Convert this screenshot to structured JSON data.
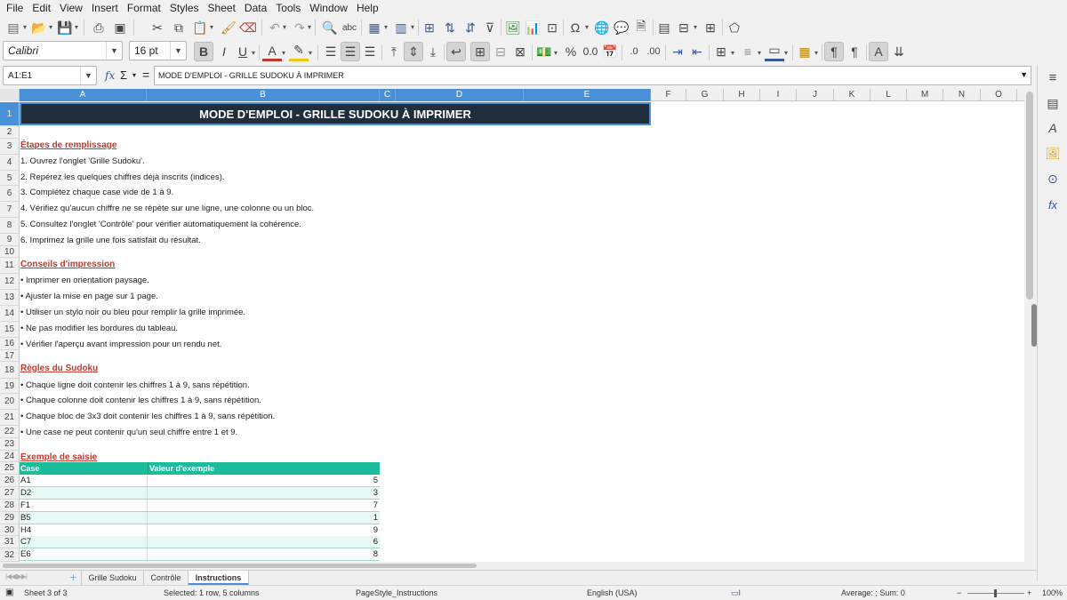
{
  "menu": [
    "File",
    "Edit",
    "View",
    "Insert",
    "Format",
    "Styles",
    "Sheet",
    "Data",
    "Tools",
    "Window",
    "Help"
  ],
  "toolbar": {
    "font_name": "Calibri",
    "font_size": "16 pt"
  },
  "formula_bar": {
    "name_box": "A1:E1",
    "fx_label": "fx",
    "sigma_label": "Σ",
    "equals_label": "=",
    "content": "MODE D'EMPLOI - GRILLE SUDOKU À IMPRIMER"
  },
  "columns": [
    "A",
    "B",
    "C",
    "D",
    "E",
    "F",
    "G",
    "H",
    "I",
    "J",
    "K",
    "L",
    "M",
    "N",
    "O"
  ],
  "rows": [
    "1",
    "2",
    "3",
    "4",
    "5",
    "6",
    "7",
    "8",
    "9",
    "10",
    "11",
    "12",
    "13",
    "14",
    "15",
    "16",
    "17",
    "18",
    "19",
    "20",
    "21",
    "22",
    "23",
    "24",
    "25",
    "26",
    "27",
    "28",
    "29",
    "30",
    "31",
    "32"
  ],
  "sheet": {
    "title": "MODE D'EMPLOI - GRILLE SUDOKU À IMPRIMER",
    "section1": {
      "heading": "Étapes de remplissage",
      "lines": [
        "1. Ouvrez l'onglet 'Grille Sudoku'.",
        "2. Repérez les quelques chiffres déjà inscrits (indices).",
        "3. Complétez chaque case vide de 1 à 9.",
        "4. Vérifiez qu'aucun chiffre ne se répète sur une ligne, une colonne ou un bloc.",
        "5. Consultez l'onglet 'Contrôle' pour vérifier automatiquement la cohérence.",
        "6. Imprimez la grille une fois satisfait du résultat."
      ]
    },
    "section2": {
      "heading": "Conseils d'impression",
      "lines": [
        "• Imprimer en orientation paysage.",
        "• Ajuster la mise en page sur 1 page.",
        "• Utiliser un stylo noir ou bleu pour remplir la grille imprimée.",
        "• Ne pas modifier les bordures du tableau.",
        "• Vérifier l'aperçu avant impression pour un rendu net."
      ]
    },
    "section3": {
      "heading": "Règles du Sudoku",
      "lines": [
        "• Chaque ligne doit contenir les chiffres 1 à 9, sans répétition.",
        "• Chaque colonne doit contenir les chiffres 1 à 9, sans répétition.",
        "• Chaque bloc de 3x3 doit contenir les chiffres 1 à 9, sans répétition.",
        "• Une case ne peut contenir qu'un seul chiffre entre 1 et 9."
      ]
    },
    "section4": {
      "heading": "Exemple de saisie",
      "table_headers": [
        "Case",
        "Valeur d'exemple"
      ],
      "table_rows": [
        {
          "case": "A1",
          "value": "5"
        },
        {
          "case": "D2",
          "value": "3"
        },
        {
          "case": "F1",
          "value": "7"
        },
        {
          "case": "B5",
          "value": "1"
        },
        {
          "case": "H4",
          "value": "9"
        },
        {
          "case": "C7",
          "value": "6"
        },
        {
          "case": "E6",
          "value": "8"
        }
      ]
    }
  },
  "tabs": [
    "Grille Sudoku",
    "Contrôle",
    "Instructions"
  ],
  "active_tab": "Instructions",
  "status": {
    "sheet_pos": "Sheet 3 of 3",
    "selection": "Selected: 1 row, 5 columns",
    "page_style": "PageStyle_Instructions",
    "language": "English (USA)",
    "summary": "Average: ; Sum: 0",
    "zoom": "100%"
  },
  "colors": {
    "title_bg": "#1f2d3d",
    "section_heading": "#c0392b",
    "table_header_bg": "#1abc9c",
    "table_row_alt": "#e8f8f5",
    "selection_blue": "#4a90d9"
  }
}
